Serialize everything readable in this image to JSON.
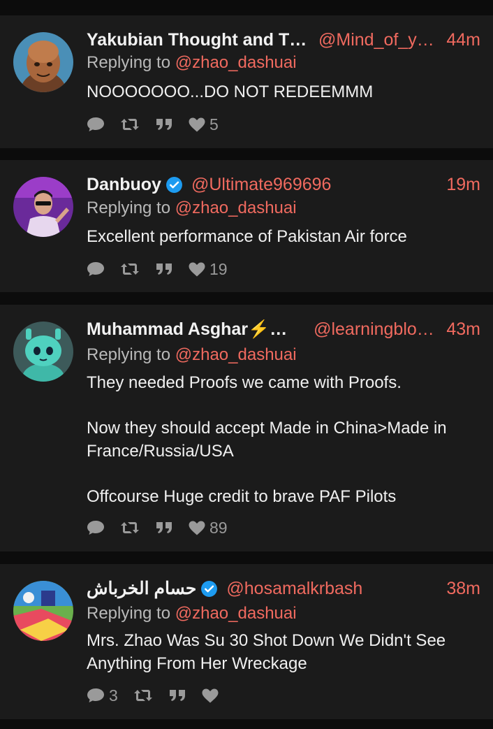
{
  "replying_label": "Replying to",
  "tweets": [
    {
      "name": "Yakubian Thought and The…",
      "verified": false,
      "handle": "@Mind_of_ya…",
      "time": "44m",
      "reply_to": "@zhao_dashuai",
      "text": [
        "NOOOOOOO...DO NOT REDEEMMM"
      ],
      "replies": "",
      "likes": "5",
      "avatar_icon": "bald-man-avatar"
    },
    {
      "name": "Danbuoy",
      "verified": true,
      "handle": "@Ultimate969696",
      "time": "19m",
      "reply_to": "@zhao_dashuai",
      "text": [
        "Excellent performance of Pakistan Air force"
      ],
      "replies": "",
      "likes": "19",
      "avatar_icon": "man-sunglasses-avatar"
    },
    {
      "name": "Muhammad Asghar⚡💵 …",
      "verified": false,
      "handle": "@learningbloc…",
      "time": "43m",
      "reply_to": "@zhao_dashuai",
      "text": [
        "They needed Proofs we came with Proofs.",
        "Now they should accept Made in China>Made in France/Russia/USA",
        "Offcourse Huge credit to brave PAF Pilots"
      ],
      "replies": "",
      "likes": "89",
      "avatar_icon": "robot-avatar"
    },
    {
      "name": "حسام الخرباش",
      "verified": true,
      "handle": "@hosamalkrbash",
      "time": "38m",
      "reply_to": "@zhao_dashuai",
      "text": [
        "Mrs. Zhao Was Su 30 Shot Down We Didn't See Anything From Her Wreckage"
      ],
      "replies": "3",
      "likes": "",
      "avatar_icon": "colorful-illustration-avatar"
    }
  ],
  "colors": {
    "background": "#0c0c0c",
    "card": "#1b1b1b",
    "accent": "#f06a5f",
    "muted": "#b9b9b9",
    "icon": "#9a9a9a",
    "verified": "#1d9bf0"
  }
}
